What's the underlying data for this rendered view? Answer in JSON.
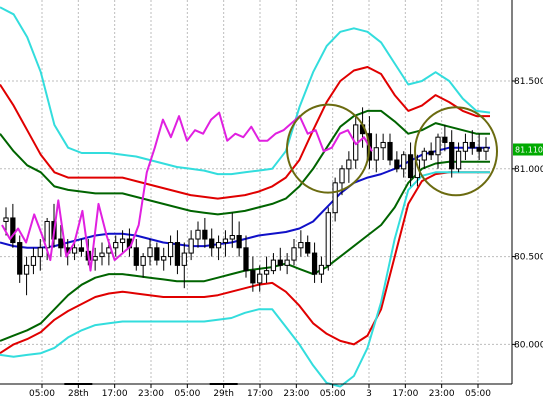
{
  "chart_data": {
    "type": "line",
    "title": "",
    "y_range": [
      79.78,
      81.95
    ],
    "grid": true,
    "y_ticks": [
      {
        "value": 81.5,
        "label": "81.500"
      },
      {
        "value": 81.0,
        "label": "81.000"
      },
      {
        "value": 80.5,
        "label": "80.500"
      },
      {
        "value": 80.0,
        "label": "80.000"
      }
    ],
    "x_ticks": [
      "05:00",
      "28th",
      "17:00",
      "23:00",
      "05:00",
      "29th",
      "17:00",
      "23:00",
      "05:00",
      "3",
      "17:00",
      "23:00",
      "05:00"
    ],
    "current_price": {
      "value": 81.11,
      "label": "81.110"
    },
    "colors": {
      "background": "#ffffff",
      "grid": "#bdbdbd",
      "ma": "#1010c8",
      "band_1sigma": "#006400",
      "band_2sigma": "#e00000",
      "band_3sigma": "#33dddd",
      "lagging_span": "#e020e0",
      "candle": "#000000",
      "highlight_circle": "#6b6b10",
      "price_badge": "#00aa00"
    },
    "series": [
      {
        "key": "ma",
        "values": [
          80.58,
          80.56,
          80.55,
          80.55,
          80.56,
          80.58,
          80.6,
          80.62,
          80.63,
          80.63,
          80.62,
          80.6,
          80.58,
          80.57,
          80.56,
          80.56,
          80.57,
          80.58,
          80.6,
          80.62,
          80.63,
          80.64,
          80.66,
          80.7,
          80.78,
          80.86,
          80.92,
          80.95,
          80.97,
          81.0,
          81.04,
          81.08,
          81.1,
          81.12,
          81.12,
          81.12,
          81.12
        ]
      },
      {
        "key": "upper_1",
        "values": [
          81.2,
          81.1,
          81.02,
          80.98,
          80.9,
          80.88,
          80.87,
          80.86,
          80.86,
          80.86,
          80.84,
          80.82,
          80.8,
          80.78,
          80.76,
          80.75,
          80.74,
          80.75,
          80.76,
          80.78,
          80.8,
          80.83,
          80.9,
          81.0,
          81.12,
          81.24,
          81.3,
          81.33,
          81.33,
          81.27,
          81.2,
          81.22,
          81.26,
          81.24,
          81.22,
          81.2,
          81.2
        ]
      },
      {
        "key": "lower_1",
        "values": [
          80.02,
          80.05,
          80.08,
          80.12,
          80.2,
          80.28,
          80.34,
          80.38,
          80.4,
          80.4,
          80.39,
          80.38,
          80.37,
          80.36,
          80.36,
          80.36,
          80.38,
          80.4,
          80.42,
          80.43,
          80.44,
          80.46,
          80.43,
          80.4,
          80.44,
          80.5,
          80.56,
          80.62,
          80.68,
          80.78,
          80.92,
          81.0,
          81.03,
          81.04,
          81.04,
          81.04,
          81.04
        ]
      },
      {
        "key": "upper_2",
        "values": [
          81.48,
          81.36,
          81.22,
          81.08,
          80.98,
          80.95,
          80.95,
          80.95,
          80.95,
          80.95,
          80.93,
          80.91,
          80.89,
          80.87,
          80.85,
          80.84,
          80.83,
          80.84,
          80.85,
          80.87,
          80.9,
          80.95,
          81.05,
          81.22,
          81.38,
          81.5,
          81.56,
          81.58,
          81.54,
          81.42,
          81.33,
          81.36,
          81.42,
          81.38,
          81.33,
          81.3,
          81.3
        ]
      },
      {
        "key": "lower_2",
        "values": [
          79.95,
          80.0,
          80.03,
          80.07,
          80.14,
          80.19,
          80.23,
          80.27,
          80.29,
          80.3,
          80.29,
          80.28,
          80.27,
          80.27,
          80.27,
          80.27,
          80.28,
          80.3,
          80.32,
          80.34,
          80.35,
          80.3,
          80.22,
          80.12,
          80.06,
          80.02,
          80.0,
          80.05,
          80.2,
          80.5,
          80.8,
          80.93,
          80.97,
          80.98,
          80.98,
          80.98,
          80.98
        ]
      },
      {
        "key": "upper_3",
        "values": [
          81.92,
          81.88,
          81.75,
          81.55,
          81.25,
          81.12,
          81.09,
          81.09,
          81.09,
          81.08,
          81.07,
          81.05,
          81.03,
          81.01,
          81.0,
          80.99,
          80.97,
          80.97,
          80.98,
          80.99,
          81.0,
          81.1,
          81.35,
          81.55,
          81.7,
          81.78,
          81.8,
          81.78,
          81.72,
          81.6,
          81.48,
          81.5,
          81.55,
          81.5,
          81.4,
          81.33,
          81.32
        ]
      },
      {
        "key": "lower_3",
        "values": [
          79.94,
          79.93,
          79.94,
          79.95,
          79.98,
          80.04,
          80.08,
          80.11,
          80.12,
          80.13,
          80.13,
          80.13,
          80.13,
          80.13,
          80.13,
          80.13,
          80.14,
          80.15,
          80.18,
          80.2,
          80.2,
          80.1,
          80.0,
          79.88,
          79.78,
          79.76,
          79.82,
          79.98,
          80.24,
          80.6,
          80.88,
          80.96,
          80.98,
          80.98,
          80.98,
          80.98,
          80.98
        ]
      },
      {
        "key": "lagging",
        "values": [
          80.68,
          80.6,
          80.66,
          80.58,
          80.74,
          80.62,
          80.48,
          80.82,
          80.5,
          80.58,
          80.76,
          80.42,
          80.8,
          80.62,
          80.48,
          80.52,
          80.56,
          80.68,
          80.98,
          81.12,
          81.28,
          81.18,
          81.3,
          81.16,
          81.22,
          81.2,
          81.28,
          81.32,
          81.16,
          81.2,
          81.18,
          81.24,
          81.16,
          81.16,
          81.2,
          81.22,
          81.26,
          81.3,
          81.2,
          81.22,
          81.1,
          81.12,
          81.2,
          81.22,
          81.14,
          81.18,
          81.1
        ]
      }
    ],
    "candles": [
      [
        80.7,
        80.78,
        80.62,
        80.72
      ],
      [
        80.72,
        80.8,
        80.55,
        80.58
      ],
      [
        80.58,
        80.62,
        80.35,
        80.4
      ],
      [
        80.4,
        80.5,
        80.28,
        80.45
      ],
      [
        80.45,
        80.55,
        80.4,
        80.5
      ],
      [
        80.5,
        80.6,
        80.42,
        80.55
      ],
      [
        80.55,
        80.72,
        80.48,
        80.7
      ],
      [
        80.7,
        80.8,
        80.55,
        80.6
      ],
      [
        80.6,
        80.68,
        80.5,
        80.55
      ],
      [
        80.55,
        80.6,
        80.45,
        80.52
      ],
      [
        80.52,
        80.6,
        80.48,
        80.55
      ],
      [
        80.55,
        80.6,
        80.5,
        80.53
      ],
      [
        80.53,
        80.6,
        80.45,
        80.48
      ],
      [
        80.48,
        80.55,
        80.42,
        80.5
      ],
      [
        80.5,
        80.58,
        80.45,
        80.52
      ],
      [
        80.52,
        80.6,
        80.45,
        80.55
      ],
      [
        80.55,
        80.62,
        80.5,
        80.58
      ],
      [
        80.58,
        80.65,
        80.52,
        80.6
      ],
      [
        80.6,
        80.66,
        80.5,
        80.55
      ],
      [
        80.55,
        80.6,
        80.42,
        80.45
      ],
      [
        80.45,
        80.52,
        80.38,
        80.5
      ],
      [
        80.5,
        80.6,
        80.45,
        80.55
      ],
      [
        80.55,
        80.58,
        80.45,
        80.48
      ],
      [
        80.48,
        80.55,
        80.42,
        80.5
      ],
      [
        80.5,
        80.62,
        80.45,
        80.58
      ],
      [
        80.58,
        80.65,
        80.4,
        80.45
      ],
      [
        80.45,
        80.58,
        80.32,
        80.52
      ],
      [
        80.52,
        80.65,
        80.48,
        80.6
      ],
      [
        80.6,
        80.7,
        80.55,
        80.65
      ],
      [
        80.65,
        80.72,
        80.55,
        80.6
      ],
      [
        80.6,
        80.66,
        80.5,
        80.55
      ],
      [
        80.55,
        80.62,
        80.48,
        80.58
      ],
      [
        80.58,
        80.65,
        80.5,
        80.6
      ],
      [
        80.6,
        80.75,
        80.55,
        80.62
      ],
      [
        80.62,
        80.7,
        80.5,
        80.55
      ],
      [
        80.55,
        80.62,
        80.38,
        80.42
      ],
      [
        80.42,
        80.5,
        80.3,
        80.35
      ],
      [
        80.35,
        80.45,
        80.3,
        80.4
      ],
      [
        80.4,
        80.5,
        80.35,
        80.42
      ],
      [
        80.42,
        80.52,
        80.4,
        80.48
      ],
      [
        80.48,
        80.55,
        80.42,
        80.45
      ],
      [
        80.45,
        80.52,
        80.4,
        80.48
      ],
      [
        80.48,
        80.6,
        80.45,
        80.55
      ],
      [
        80.55,
        80.65,
        80.5,
        80.58
      ],
      [
        80.58,
        80.62,
        80.5,
        80.52
      ],
      [
        80.52,
        80.58,
        80.35,
        80.4
      ],
      [
        80.4,
        80.5,
        80.35,
        80.45
      ],
      [
        80.45,
        80.78,
        80.42,
        80.75
      ],
      [
        80.75,
        80.95,
        80.7,
        80.92
      ],
      [
        80.92,
        81.02,
        80.85,
        81.0
      ],
      [
        81.0,
        81.1,
        80.92,
        81.05
      ],
      [
        81.05,
        81.3,
        81.0,
        81.25
      ],
      [
        81.25,
        81.35,
        81.12,
        81.2
      ],
      [
        81.2,
        81.3,
        81.0,
        81.05
      ],
      [
        81.05,
        81.2,
        80.98,
        81.12
      ],
      [
        81.12,
        81.2,
        81.05,
        81.15
      ],
      [
        81.15,
        81.2,
        81.02,
        81.05
      ],
      [
        81.05,
        81.1,
        80.98,
        81.0
      ],
      [
        81.0,
        81.1,
        80.95,
        81.08
      ],
      [
        81.08,
        81.15,
        80.9,
        80.95
      ],
      [
        80.95,
        81.08,
        80.9,
        81.05
      ],
      [
        81.05,
        81.12,
        81.0,
        81.1
      ],
      [
        81.1,
        81.15,
        81.05,
        81.08
      ],
      [
        81.08,
        81.2,
        81.0,
        81.18
      ],
      [
        81.18,
        81.25,
        81.1,
        81.15
      ],
      [
        81.15,
        81.22,
        80.95,
        81.0
      ],
      [
        81.0,
        81.15,
        80.98,
        81.1
      ],
      [
        81.1,
        81.2,
        81.05,
        81.15
      ],
      [
        81.15,
        81.22,
        81.08,
        81.12
      ],
      [
        81.12,
        81.2,
        81.05,
        81.1
      ],
      [
        81.1,
        81.18,
        81.05,
        81.12
      ]
    ],
    "highlight_circles": [
      {
        "center": [
          81.05,
          81.18
        ],
        "label": ""
      },
      {
        "center": [
          81.1,
          81.1
        ],
        "label": ""
      }
    ]
  }
}
